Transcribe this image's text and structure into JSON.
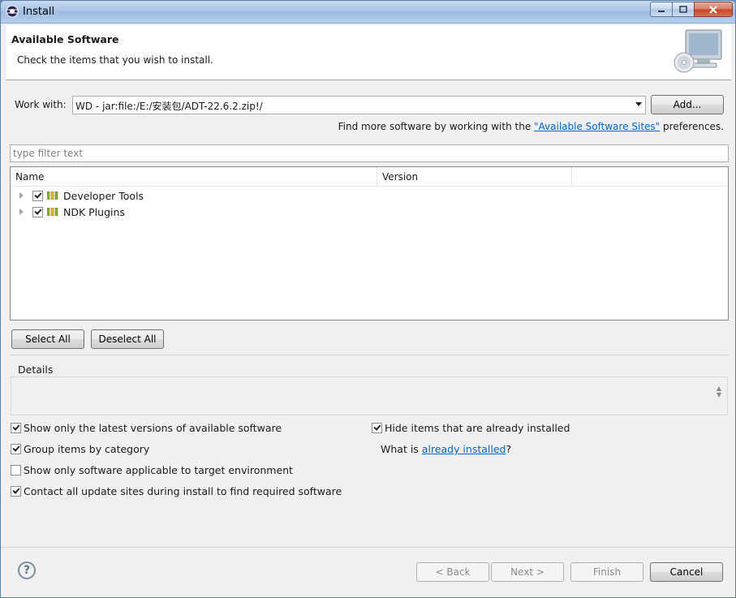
{
  "window": {
    "title": "Install"
  },
  "header": {
    "title": "Available Software",
    "description": "Check the items that you wish to install."
  },
  "work_with": {
    "label": "Work with:",
    "value": "WD - jar:file:/E:/安装包/ADT-22.6.2.zip!/",
    "add_label": "Add...",
    "hint_prefix": "Find more software by working with the ",
    "hint_link": "\"Available Software Sites\"",
    "hint_suffix": " preferences."
  },
  "filter": {
    "placeholder": "type filter text"
  },
  "tree": {
    "columns": [
      "Name",
      "Version"
    ],
    "rows": [
      {
        "label": "Developer Tools",
        "checked": true
      },
      {
        "label": "NDK Plugins",
        "checked": true
      }
    ]
  },
  "actions": {
    "select_all": "Select All",
    "deselect_all": "Deselect All"
  },
  "details": {
    "title": "Details"
  },
  "options": {
    "latest_versions": "Show only the latest versions of available software",
    "group_by_category": "Group items by category",
    "applicable_only": "Show only software applicable to target environment",
    "contact_sites": "Contact all update sites during install to find required software",
    "hide_installed": "Hide items that are already installed",
    "what_is_prefix": "What is ",
    "what_is_link": "already installed",
    "what_is_suffix": "?"
  },
  "footer": {
    "help_glyph": "?",
    "back": "< Back",
    "next": "Next >",
    "finish": "Finish",
    "cancel": "Cancel"
  }
}
